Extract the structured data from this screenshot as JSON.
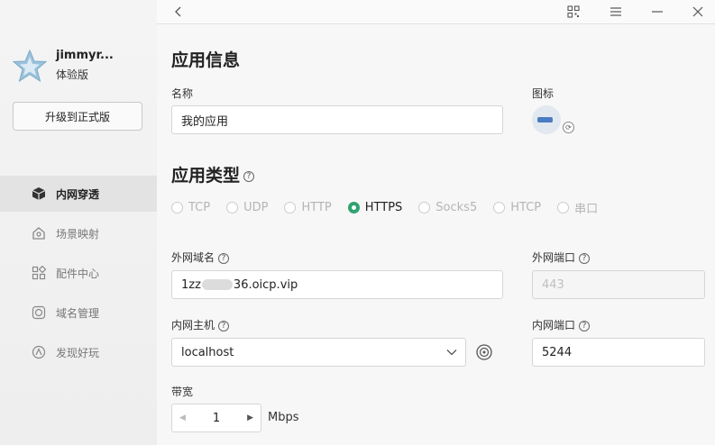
{
  "user": {
    "name": "jimmyr...",
    "plan": "体验版",
    "upgrade_label": "升级到正式版"
  },
  "sidebar": {
    "items": [
      {
        "label": "内网穿透",
        "icon": "cube-icon",
        "active": true
      },
      {
        "label": "场景映射",
        "icon": "scene-map-icon",
        "active": false
      },
      {
        "label": "配件中心",
        "icon": "apps-grid-icon",
        "active": false
      },
      {
        "label": "域名管理",
        "icon": "domain-icon",
        "active": false
      },
      {
        "label": "发现好玩",
        "icon": "discover-icon",
        "active": false
      }
    ]
  },
  "toolbar": {
    "icons": [
      "back-icon",
      "qr-code-icon",
      "menu-icon",
      "minimize-icon",
      "close-icon"
    ]
  },
  "app_info": {
    "heading": "应用信息",
    "name_label": "名称",
    "name_value": "我的应用",
    "icon_label": "图标"
  },
  "app_type": {
    "heading": "应用类型",
    "options": [
      "TCP",
      "UDP",
      "HTTP",
      "HTTPS",
      "Socks5",
      "HTCP",
      "串口"
    ],
    "selected": "HTTPS"
  },
  "fields": {
    "ext_domain_label": "外网域名",
    "ext_domain_prefix": "1zz",
    "ext_domain_suffix": "36.oicp.vip",
    "ext_port_label": "外网端口",
    "ext_port_placeholder": "443",
    "int_host_label": "内网主机",
    "int_host_value": "localhost",
    "int_port_label": "内网端口",
    "int_port_value": "5244",
    "bandwidth_label": "带宽",
    "bandwidth_value": "1",
    "bandwidth_unit": "Mbps"
  },
  "colors": {
    "accent": "#2fa371",
    "sidebar_bg": "#f1f1f1",
    "active_nav": "#e3e3e3"
  }
}
